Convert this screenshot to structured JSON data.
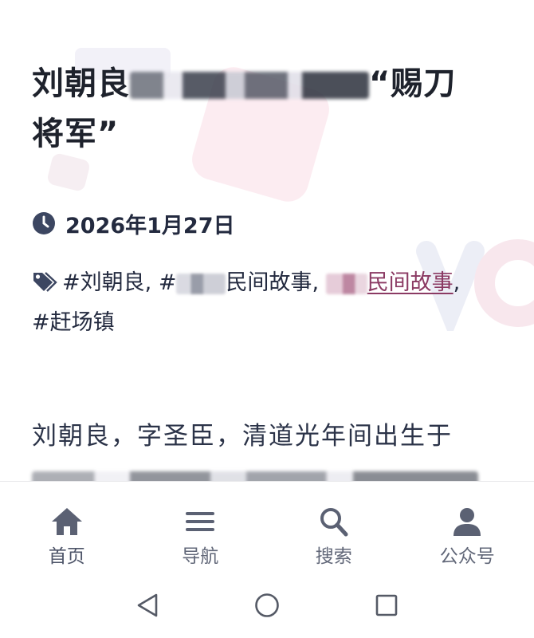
{
  "article": {
    "title_start": "刘朝良",
    "title_quote": "“赐刀",
    "title_line2": "将军”",
    "date": "2026年1月27日",
    "tags": {
      "tag1": "#刘朝良",
      "sep": ",",
      "tag2_prefix": "#",
      "tag2_suffix": "民间故事",
      "tag3_suffix": "民间故事",
      "tag4": "#赶场镇"
    },
    "body_line1": "刘朝良，字圣臣，清道光年间出生于"
  },
  "nav": {
    "items": [
      {
        "label": "首页",
        "icon": "home-icon"
      },
      {
        "label": "导航",
        "icon": "menu-icon"
      },
      {
        "label": "搜索",
        "icon": "search-icon"
      },
      {
        "label": "公众号",
        "icon": "user-icon"
      }
    ]
  },
  "system_bar": {
    "buttons": [
      "back-triangle-icon",
      "home-circle-icon",
      "recents-square-icon"
    ]
  },
  "colors": {
    "text_dark": "#1e222c",
    "meta_text": "#232a3f",
    "link": "#8b3a63",
    "nav_icon": "#5b6173"
  }
}
